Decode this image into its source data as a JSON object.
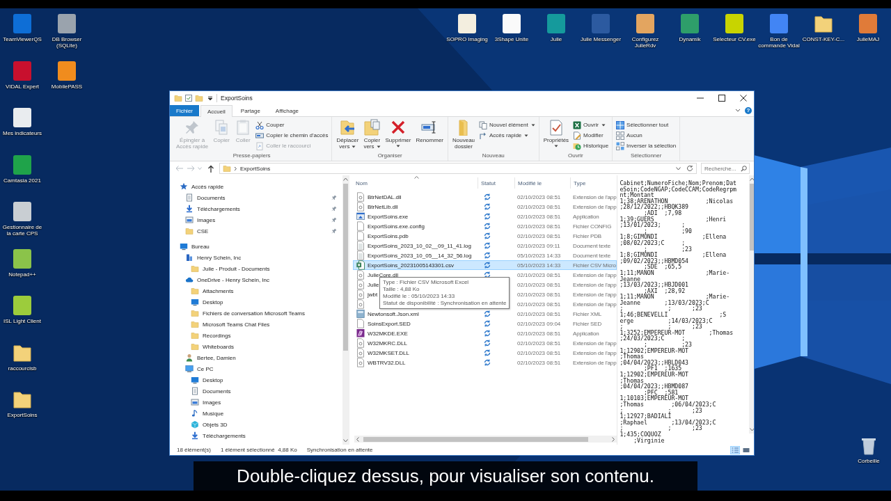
{
  "desktop": {
    "icons_left": [
      {
        "label": "TeamViewerQS",
        "kind": "app",
        "color": "#0e6ed6"
      },
      {
        "label": "VIDAL Expert",
        "kind": "app",
        "color": "#c8102e"
      },
      {
        "label": "Mes indicateurs",
        "kind": "app",
        "color": "#e9ecef"
      },
      {
        "label": "Camtasia 2021",
        "kind": "app",
        "color": "#1fa34a"
      },
      {
        "lines": [
          "Gestionnaire de",
          "la carte CPS"
        ],
        "kind": "app",
        "color": "#c9ced3"
      },
      {
        "label": "Notepad++",
        "kind": "app",
        "color": "#8bc34a"
      },
      {
        "label": "ISL Light Client",
        "kind": "app",
        "color": "#9ccc3c"
      },
      {
        "label": "raccourcisb",
        "kind": "folder"
      },
      {
        "label": "ExportSoins",
        "kind": "folder"
      },
      {
        "lines": [
          "DB Browser",
          "(SQLite)"
        ],
        "kind": "app",
        "color": "#9aa3ad"
      },
      {
        "label": "MobilePASS",
        "kind": "app",
        "color": "#f08c1e"
      }
    ],
    "icons_top": [
      {
        "label": "SOPRO Imaging",
        "kind": "app",
        "color": "#f3eedf"
      },
      {
        "label": "3Shape Unite",
        "kind": "app",
        "color": "#fafafa"
      },
      {
        "label": "Julie",
        "kind": "app",
        "color": "#159a9c"
      },
      {
        "label": "Julie Messenger",
        "kind": "app",
        "color": "#2c5aa0"
      },
      {
        "lines": [
          "Configurez",
          "JulieRdv"
        ],
        "kind": "app",
        "color": "#e3a560"
      },
      {
        "label": "Dynamik",
        "kind": "app",
        "color": "#2e9e6a"
      },
      {
        "label": "Selecteur CV.exe",
        "kind": "app",
        "color": "#c8d400"
      },
      {
        "lines": [
          "Bon de",
          "commande Vidal"
        ],
        "kind": "app",
        "color": "#4285f4"
      },
      {
        "label": "CONST-KEY-C...",
        "kind": "folder"
      },
      {
        "label": "JulieMAJ",
        "kind": "app",
        "color": "#e07b39"
      }
    ],
    "icons_corner": [
      {
        "label": "Corbeille",
        "kind": "recycle"
      }
    ]
  },
  "window": {
    "title": "ExportSoins"
  },
  "ribbon_tabs": [
    {
      "label": "Fichier",
      "kind": "file",
      "selected": false
    },
    {
      "label": "Accueil",
      "kind": "tab",
      "selected": true
    },
    {
      "label": "Partage",
      "kind": "tab",
      "selected": false
    },
    {
      "label": "Affichage",
      "kind": "tab",
      "selected": false
    }
  ],
  "ribbon_help": "?",
  "ribbon_groups": [
    {
      "label": "Presse-papiers",
      "items": [
        {
          "kind": "large",
          "lines": [
            "Épingler à",
            "Accès rapide"
          ],
          "disabled": true,
          "dropdown": false
        },
        {
          "kind": "large",
          "lines": [
            "Copier"
          ],
          "disabled": true,
          "dropdown": false
        },
        {
          "kind": "large",
          "lines": [
            "Coller"
          ],
          "disabled": true,
          "dropdown": false
        },
        {
          "kind": "small",
          "label": "Couper",
          "disabled": false,
          "dropdown": false
        },
        {
          "kind": "small",
          "label": "Copier le chemin d'accès",
          "disabled": false,
          "dropdown": false
        },
        {
          "kind": "small",
          "label": "Coller le raccourci",
          "disabled": true,
          "dropdown": false
        }
      ]
    },
    {
      "label": "Organiser",
      "items": [
        {
          "kind": "large",
          "lines": [
            "Déplacer",
            "vers"
          ],
          "disabled": false,
          "dropdown": true
        },
        {
          "kind": "large",
          "lines": [
            "Copier",
            "vers"
          ],
          "disabled": false,
          "dropdown": true
        },
        {
          "kind": "large",
          "lines": [
            "Supprimer"
          ],
          "disabled": false,
          "dropdown": true
        },
        {
          "kind": "large",
          "lines": [
            "Renommer"
          ],
          "disabled": false,
          "dropdown": false
        }
      ]
    },
    {
      "label": "Nouveau",
      "items": [
        {
          "kind": "large",
          "lines": [
            "Nouveau",
            "dossier"
          ],
          "disabled": false,
          "dropdown": false
        },
        {
          "kind": "small",
          "label": "Nouvel élément",
          "disabled": false,
          "dropdown": true
        },
        {
          "kind": "small",
          "label": "Accès rapide",
          "disabled": false,
          "dropdown": true
        }
      ]
    },
    {
      "label": "Ouvrir",
      "items": [
        {
          "kind": "large",
          "lines": [
            "Propriétés"
          ],
          "disabled": false,
          "dropdown": true
        },
        {
          "kind": "small",
          "label": "Ouvrir",
          "disabled": false,
          "dropdown": true
        },
        {
          "kind": "small",
          "label": "Modifier",
          "disabled": false,
          "dropdown": false
        },
        {
          "kind": "small",
          "label": "Historique",
          "disabled": false,
          "dropdown": false
        }
      ]
    },
    {
      "label": "Sélectionner",
      "items": [
        {
          "kind": "small",
          "label": "Sélectionner tout",
          "disabled": false,
          "dropdown": false
        },
        {
          "kind": "small",
          "label": "Aucun",
          "disabled": false,
          "dropdown": false
        },
        {
          "kind": "small",
          "label": "Inverser la sélection",
          "disabled": false,
          "dropdown": false
        }
      ]
    }
  ],
  "address_bar": {
    "crumbs": [
      "ExportSoins"
    ]
  },
  "search": {
    "placeholder": "Recherche..."
  },
  "navigation_pane": {
    "items": [
      {
        "label": "Accès rapide",
        "kind": "star",
        "children": [
          {
            "label": "Documents",
            "kind": "documents",
            "pinned": true
          },
          {
            "label": "Téléchargements",
            "kind": "download",
            "pinned": true
          },
          {
            "label": "Images",
            "kind": "images",
            "pinned": true
          },
          {
            "label": "CSE",
            "kind": "folder",
            "pinned": true
          }
        ]
      },
      {
        "label": "Bureau",
        "kind": "desktop",
        "children": [
          {
            "label": "Henry Schein, Inc",
            "kind": "building",
            "children": [
              {
                "label": "Julie - Produit - Documents",
                "kind": "folder"
              }
            ]
          },
          {
            "label": "OneDrive - Henry Schein, Inc",
            "kind": "cloud",
            "children": [
              {
                "label": "Attachments",
                "kind": "folder"
              },
              {
                "label": "Desktop",
                "kind": "desktop"
              },
              {
                "label": "Fichiers de conversation Microsoft Teams",
                "kind": "folder"
              },
              {
                "label": "Microsoft Teams Chat Files",
                "kind": "folder"
              },
              {
                "label": "Recordings",
                "kind": "folder"
              },
              {
                "label": "Whiteboards",
                "kind": "folder"
              }
            ]
          },
          {
            "label": "Bertee, Damien",
            "kind": "person"
          },
          {
            "label": "Ce PC",
            "kind": "pc",
            "children": [
              {
                "label": "Desktop",
                "kind": "desktop"
              },
              {
                "label": "Documents",
                "kind": "documents"
              },
              {
                "label": "Images",
                "kind": "images"
              },
              {
                "label": "Musique",
                "kind": "music"
              },
              {
                "label": "Objets 3D",
                "kind": "cube"
              },
              {
                "label": "Téléchargements",
                "kind": "download"
              }
            ]
          }
        ]
      }
    ]
  },
  "file_list": {
    "columns": [
      {
        "label": "Nom",
        "sorted": true
      },
      {
        "label": "Statut",
        "sorted": false
      },
      {
        "label": "Modifié le",
        "sorted": false
      },
      {
        "label": "Type",
        "sorted": false
      }
    ],
    "rows": [
      {
        "name": "BtrNetDAL.dll",
        "kind": "dll",
        "synced": true,
        "modified": "02/10/2023 08:51",
        "type": "Extension de l'app",
        "selected": false
      },
      {
        "name": "BtrNetLib.dll",
        "kind": "dll",
        "synced": true,
        "modified": "02/10/2023 08:51",
        "type": "Extension de l'app",
        "selected": false
      },
      {
        "name": "ExportSoins.exe",
        "kind": "exe",
        "synced": true,
        "modified": "02/10/2023 08:51",
        "type": "Application",
        "selected": false
      },
      {
        "name": "ExportSoins.exe.config",
        "kind": "blank",
        "synced": true,
        "modified": "02/10/2023 08:51",
        "type": "Fichier CONFIG",
        "selected": false
      },
      {
        "name": "ExportSoins.pdb",
        "kind": "blank",
        "synced": true,
        "modified": "02/10/2023 08:51",
        "type": "Fichier PDB",
        "selected": false
      },
      {
        "name": "ExportSoins_2023_10_02__09_11_41.log",
        "kind": "text",
        "synced": true,
        "modified": "02/10/2023 09:11",
        "type": "Document texte",
        "selected": false
      },
      {
        "name": "ExportSoins_2023_10_05__14_32_56.log",
        "kind": "text",
        "synced": true,
        "modified": "05/10/2023 14:33",
        "type": "Document texte",
        "selected": false
      },
      {
        "name": "ExportSoins_20231005143301.csv",
        "kind": "csv",
        "synced": true,
        "modified": "05/10/2023 14:33",
        "type": "Fichier CSV Micro",
        "selected": true
      },
      {
        "name": "JulieCore.dll",
        "kind": "dll",
        "synced": true,
        "modified": "02/10/2023 08:51",
        "type": "Extension de l'app",
        "selected": false
      },
      {
        "name": "Julie",
        "kind": "dll",
        "modified": "02/10/2023 08:51",
        "type": "Extension de l'app",
        "selected": false
      },
      {
        "name": "jwbt",
        "kind": "dll",
        "modified": "02/10/2023 08:51",
        "type": "Extension de l'app",
        "selected": false
      },
      {
        "kind": "dll",
        "modified": "02/10/2023 08:51",
        "type": "Extension de l'app",
        "selected": false
      },
      {
        "name": "Newtonsoft.Json.xml",
        "kind": "xml",
        "synced": true,
        "modified": "02/10/2023 08:51",
        "type": "Fichier XML",
        "selected": false
      },
      {
        "name": "SoinsExport.SED",
        "kind": "blank",
        "synced": true,
        "modified": "02/10/2023 09:04",
        "type": "Fichier SED",
        "selected": false
      },
      {
        "name": "W32MKDE.EXE",
        "kind": "purple",
        "synced": true,
        "modified": "02/10/2023 08:51",
        "type": "Application",
        "selected": false
      },
      {
        "name": "W32MKRC.DLL",
        "kind": "dll",
        "synced": true,
        "modified": "02/10/2023 08:51",
        "type": "Extension de l'app",
        "selected": false
      },
      {
        "name": "W32MKSET.DLL",
        "kind": "dll",
        "synced": true,
        "modified": "02/10/2023 08:51",
        "type": "Extension de l'app",
        "selected": false
      },
      {
        "name": "WBTRV32.DLL",
        "kind": "dll",
        "synced": true,
        "modified": "02/10/2023 08:51",
        "type": "Extension de l'app",
        "selected": false
      }
    ]
  },
  "tooltip": {
    "lines": [
      "Type : Fichier CSV Microsoft Excel",
      "Taille : 4,88 Ko",
      "Modifié le : 05/10/2023 14:33",
      "Statut de disponibilité : Synchronisation en attente"
    ]
  },
  "preview": {
    "lines": [
      "Cabinet;NumeroFiche;Nom;Prenom;Dat",
      "eSoin;CodeNGAP;CodeCCAM;CodeRegrpm",
      "nt;Montant",
      "1;38;ARENATHON           ;Nicolas",
      ";28/12/2022;;HBQK389",
      "       ;ADI  ;7,98",
      "1;39;GUERS               ;Henri",
      ";13/01/2023;      ;",
      "       ;          ;90",
      "1;8;GIMONDI             ;Ellena",
      ";08/02/2023;C     ;",
      "       ;          ;23",
      "1;8;GIMONDI             ;Ellena",
      ";09/02/2023;;HBMD054",
      "       ;SDE  ;65,5",
      "1;11;MANON               ;Marie-",
      "Jeanne",
      ";13/03/2023;;HBJD001",
      "       ;AXI  ;28,92",
      "1;11;MANON               ;Marie-",
      "Jeanne       ;13/03/2023;C",
      ";             ;      ;23",
      "1;46;BENEVELLI               ;S",
      "erge          ;14/03/2023;C",
      ";             ;      ;23",
      "1;3252;EMPEREUR-MOT       ;Thomas",
      ";24/03/2023;C     ;",
      "       ;          ;23",
      "1;12902;EMPEREUR-MOT",
      ";Thomas",
      ";04/04/2023;;HBLD043",
      "       ;PF1  ;1635",
      "1;12902;EMPEREUR-MOT",
      ";Thomas",
      ";04/04/2023;;HBMD087",
      "       ;PFC  ;581",
      "1;10103;EMPEREUR-MOT",
      ";Thomas        ;06/04/2023;C",
      ";             ;      ;23",
      "1;12927;BADIALI",
      ";Raphael       ;13/04/2023;C",
      ";             ;      ;23",
      "1;435;COQUOZ",
      "    ;Virginie"
    ]
  },
  "status_bar": {
    "item_count": "18 élément(s)",
    "selection": "1 élément sélectionné  4,88 Ko",
    "sync_status": "Synchronisation en attente",
    "views": [
      {
        "kind": "details",
        "selected": true
      },
      {
        "kind": "tiles",
        "selected": false
      }
    ]
  },
  "caption": "Double-cliquez dessus, pour visualiser son contenu."
}
